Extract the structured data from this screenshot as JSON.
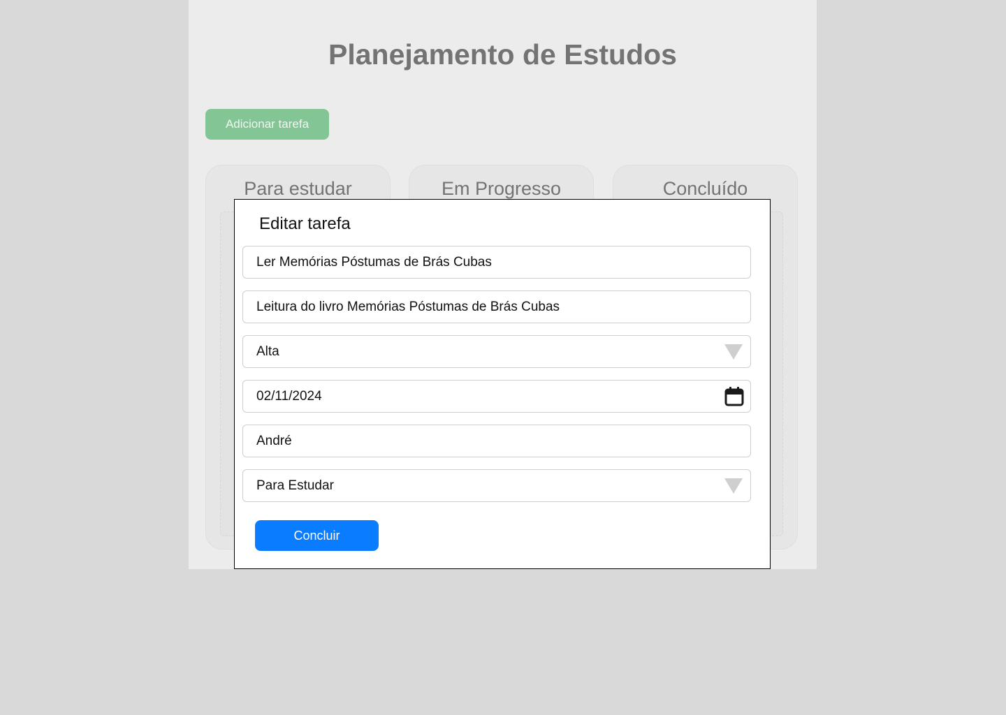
{
  "app": {
    "title": "Planejamento de Estudos",
    "add_task_label": "Adicionar tarefa",
    "columns": [
      {
        "label": "Para estudar"
      },
      {
        "label": "Em Progresso"
      },
      {
        "label": "Concluído"
      }
    ]
  },
  "modal": {
    "title": "Editar tarefa",
    "fields": {
      "task_name": "Ler Memórias Póstumas de Brás Cubas",
      "description": "Leitura do livro Memórias Póstumas de Brás Cubas",
      "priority": "Alta",
      "due_date": "02/11/2024",
      "responsible": "André",
      "status": "Para Estudar"
    },
    "submit_label": "Concluir"
  },
  "icons": {
    "priority_dropdown": "chevron-down-icon",
    "date_picker": "calendar-icon",
    "status_dropdown": "chevron-down-icon"
  },
  "colors": {
    "page_background": "#d9d9d9",
    "app_background": "#ececec",
    "add_button": "#84c596",
    "submit_button": "#0a7cff",
    "title_text": "#737373"
  }
}
